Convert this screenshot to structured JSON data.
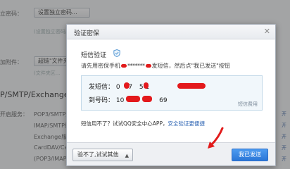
{
  "background": {
    "rows": [
      {
        "label": "立密码：",
        "button": "设置独立密码..."
      },
      {
        "label": "",
        "hint": "(设置独立密码后..."
      },
      {
        "label": "加附件：",
        "button": "超链\"文件夹"
      },
      {
        "label": "",
        "hint": "(文件夹区..."
      }
    ],
    "section_title": "P/SMTP/Exchange",
    "services_label": "开启服务：",
    "services": [
      "POP3/SMTP服务",
      "IMAP/SMTP服务",
      "Exchange服务",
      "CardDAV/CalDAV",
      "(POP3/IMAP"
    ],
    "right_links": [
      "开",
      "开",
      "开",
      "开",
      "开"
    ]
  },
  "modal": {
    "title": "验证密保",
    "close_glyph": "✕",
    "verify_title": "短信验证",
    "instruction": {
      "before": "请先用密保手机",
      "masked": "*******",
      "after": "发短信，然后点\"我已发送\"按钮"
    },
    "sms": {
      "content_label": "发短信：",
      "content_value_start": "0",
      "content_value_mid": "7",
      "content_value_end": "5 1",
      "to_label": "到号码：",
      "to_value_start": "10",
      "to_value_end": "69",
      "note": "短信费用"
    },
    "help": {
      "text": "短信用不了？试试QQ安全中心APP，",
      "link": "安全验证更便捷"
    },
    "alt_button": "验不了,试试其他",
    "alt_caret": "▲",
    "sent_button": "我已发送"
  },
  "colors": {
    "primary_button": "#2a76d7",
    "annotation_red": "#e21b1b",
    "link": "#2d64b3"
  }
}
